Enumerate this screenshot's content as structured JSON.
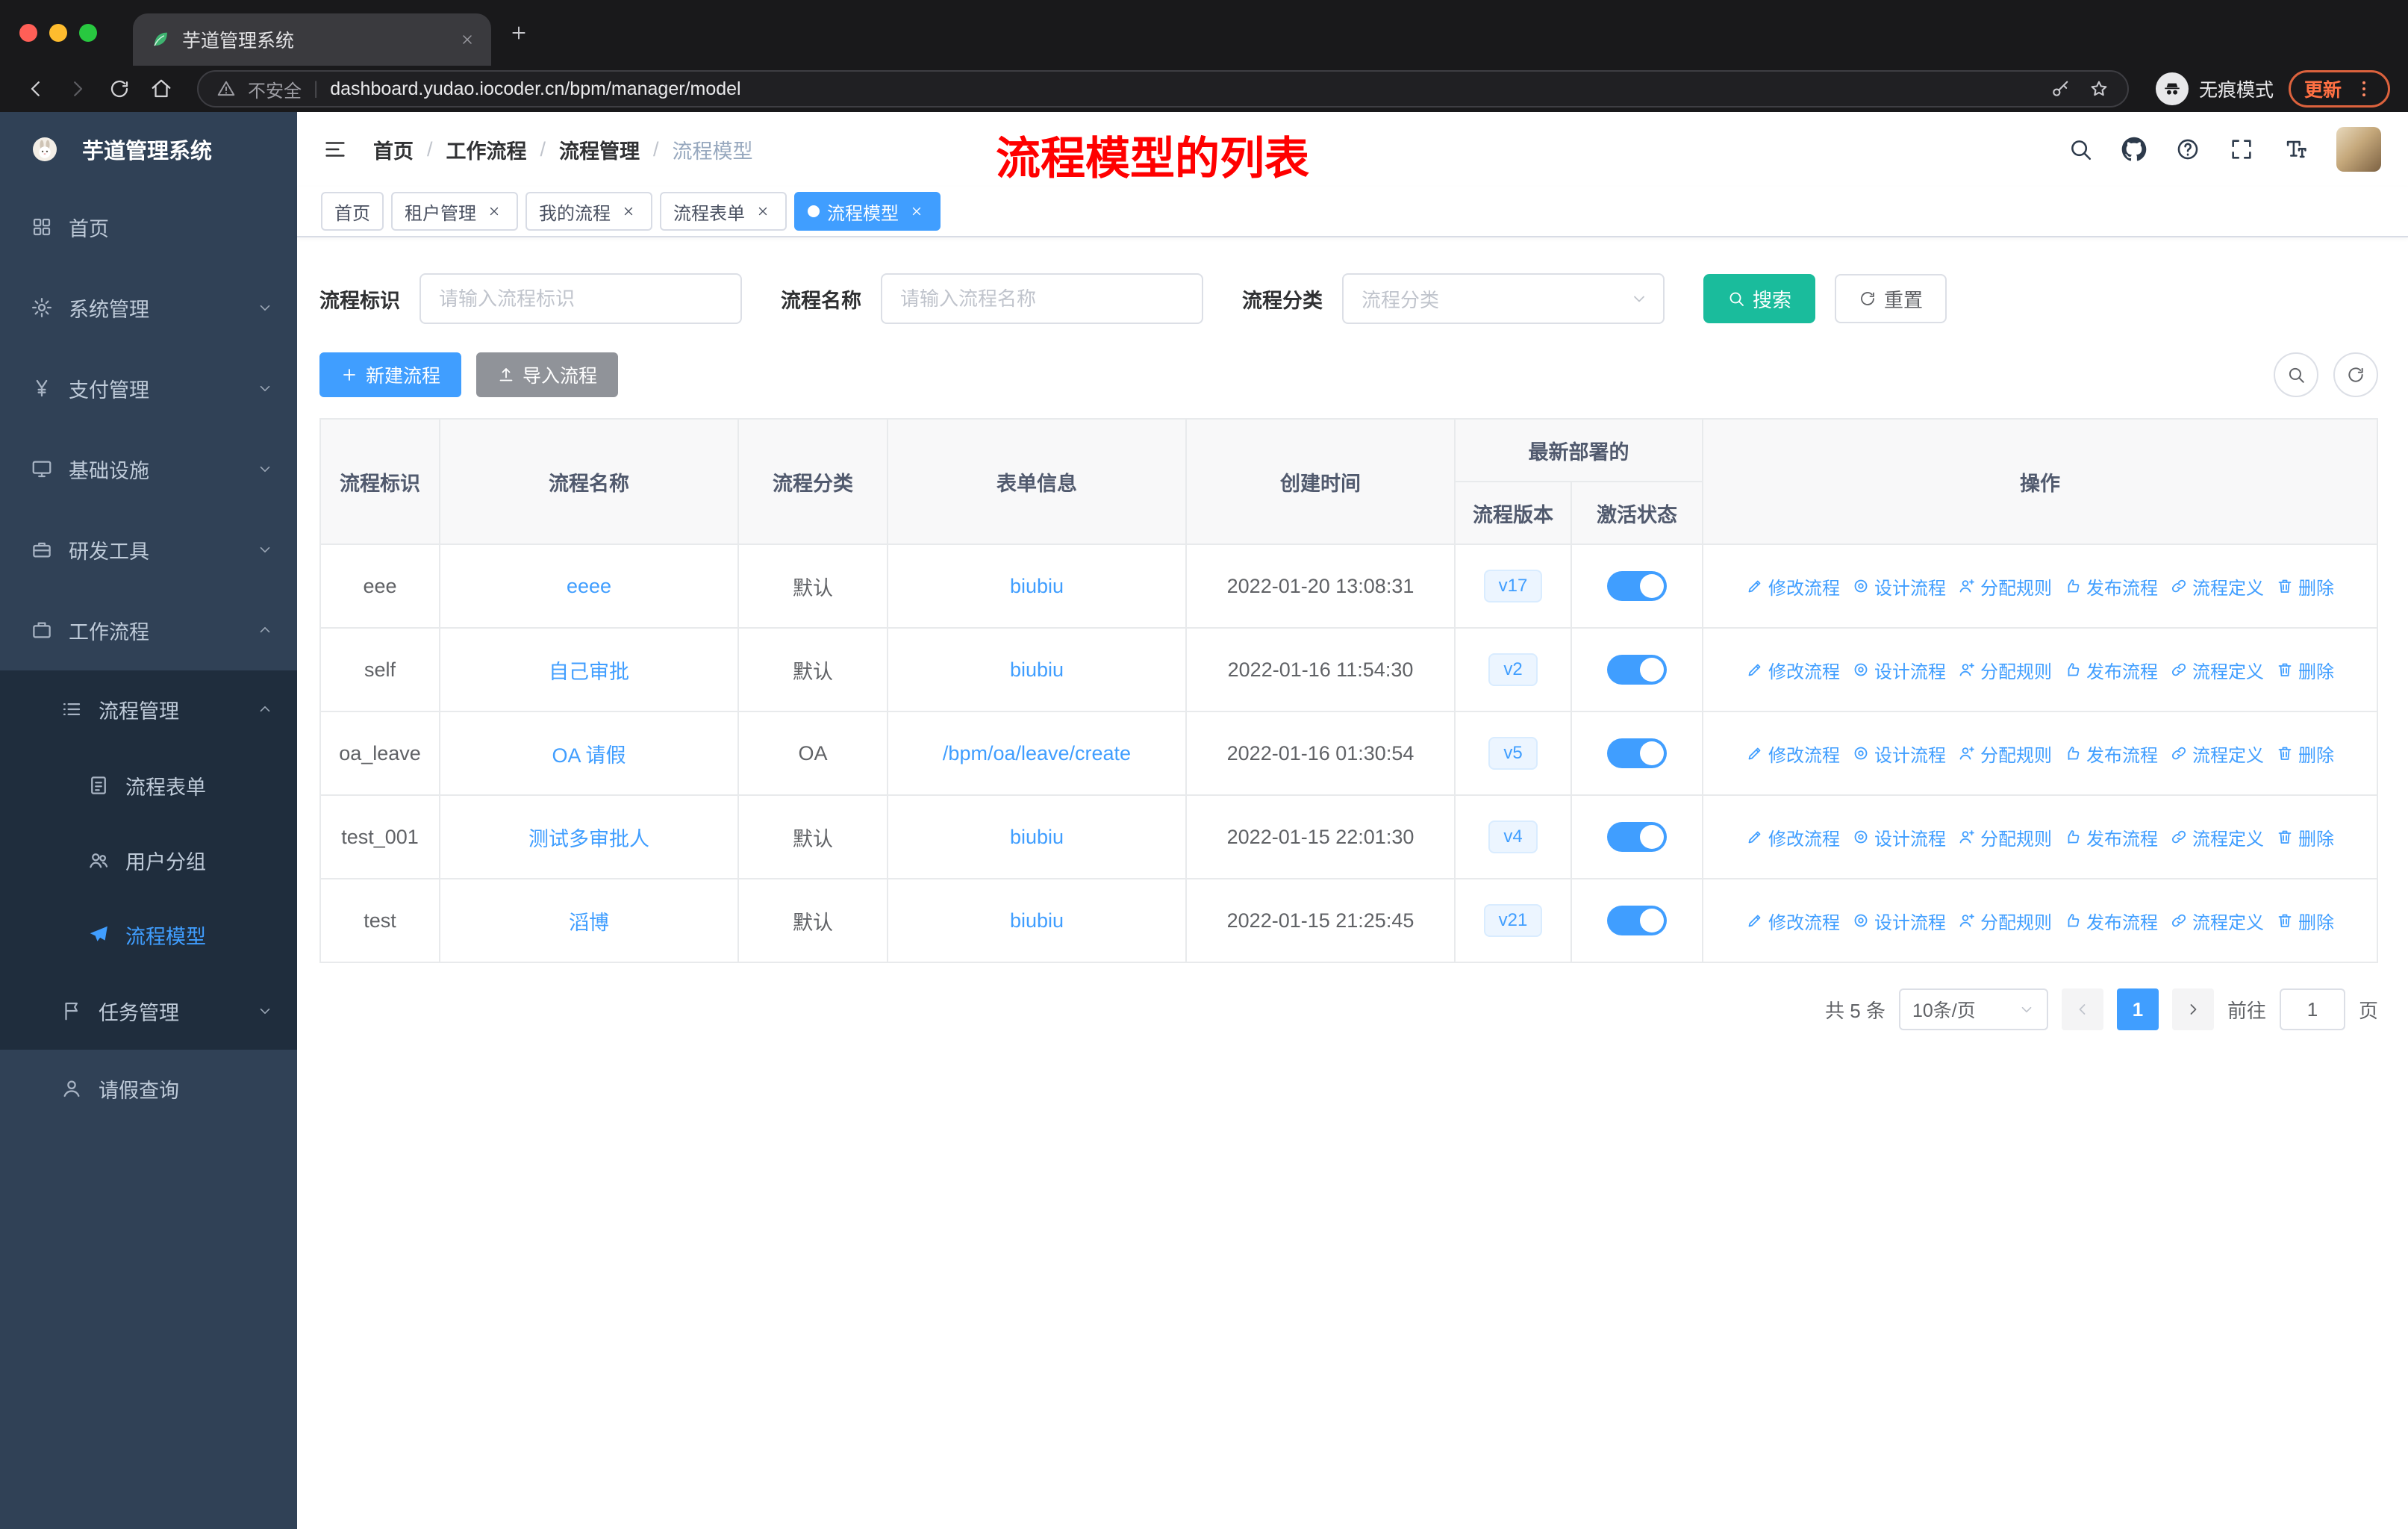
{
  "browser": {
    "tab_title": "芋道管理系统",
    "security_label": "不安全",
    "url": "dashboard.yudao.iocoder.cn/bpm/manager/model",
    "incognito_label": "无痕模式",
    "update_label": "更新"
  },
  "sidebar": {
    "logo_title": "芋道管理系统",
    "menu": [
      {
        "name": "home",
        "label": "首页",
        "icon": "dashboard-icon",
        "level": 1
      },
      {
        "name": "system-mgmt",
        "label": "系统管理",
        "icon": "gear-icon",
        "level": 1,
        "chevron": "down"
      },
      {
        "name": "payment-mgmt",
        "label": "支付管理",
        "icon": "yen-icon",
        "level": 1,
        "chevron": "down"
      },
      {
        "name": "infrastructure",
        "label": "基础设施",
        "icon": "monitor-icon",
        "level": 1,
        "chevron": "down"
      },
      {
        "name": "dev-tools",
        "label": "研发工具",
        "icon": "toolbox-icon",
        "level": 1,
        "chevron": "down"
      },
      {
        "name": "workflow",
        "label": "工作流程",
        "icon": "briefcase-icon",
        "level": 1,
        "chevron": "up"
      },
      {
        "name": "process-mgmt",
        "label": "流程管理",
        "icon": "list-icon",
        "level": 2,
        "chevron": "up",
        "dark": true
      },
      {
        "name": "process-form",
        "label": "流程表单",
        "icon": "document-icon",
        "level": 3,
        "dark": true
      },
      {
        "name": "user-group",
        "label": "用户分组",
        "icon": "users-icon",
        "level": 3,
        "dark": true
      },
      {
        "name": "process-model",
        "label": "流程模型",
        "icon": "send-icon",
        "level": 3,
        "dark": true,
        "active": true
      },
      {
        "name": "task-mgmt",
        "label": "任务管理",
        "icon": "flag-icon",
        "level": 2,
        "chevron": "down",
        "dark": true
      },
      {
        "name": "leave-query",
        "label": "请假查询",
        "icon": "user-icon",
        "level": 2
      }
    ]
  },
  "header": {
    "breadcrumb": [
      "首页",
      "工作流程",
      "流程管理",
      "流程模型"
    ],
    "annotation": "流程模型的列表"
  },
  "tags": [
    {
      "name": "home",
      "label": "首页",
      "closable": false,
      "active": false
    },
    {
      "name": "tenant-mgmt",
      "label": "租户管理",
      "closable": true,
      "active": false
    },
    {
      "name": "my-process",
      "label": "我的流程",
      "closable": true,
      "active": false
    },
    {
      "name": "process-form",
      "label": "流程表单",
      "closable": true,
      "active": false
    },
    {
      "name": "process-model",
      "label": "流程模型",
      "closable": true,
      "active": true
    }
  ],
  "filters": {
    "key_label": "流程标识",
    "key_placeholder": "请输入流程标识",
    "name_label": "流程名称",
    "name_placeholder": "请输入流程名称",
    "category_label": "流程分类",
    "category_placeholder": "流程分类",
    "search_label": "搜索",
    "reset_label": "重置"
  },
  "toolbar": {
    "create_label": "新建流程",
    "import_label": "导入流程"
  },
  "table": {
    "col_key": "流程标识",
    "col_name": "流程名称",
    "col_category": "流程分类",
    "col_form": "表单信息",
    "col_created": "创建时间",
    "group_header": "最新部署的",
    "col_version": "流程版本",
    "col_active": "激活状态",
    "col_ops": "操作",
    "actions": [
      {
        "name": "modify",
        "label": "修改流程",
        "icon": "edit-icon"
      },
      {
        "name": "design",
        "label": "设计流程",
        "icon": "design-icon"
      },
      {
        "name": "assign-rule",
        "label": "分配规则",
        "icon": "assign-user-icon"
      },
      {
        "name": "publish",
        "label": "发布流程",
        "icon": "publish-icon"
      },
      {
        "name": "definition",
        "label": "流程定义",
        "icon": "definition-icon"
      },
      {
        "name": "delete",
        "label": "删除",
        "icon": "trash-icon"
      }
    ],
    "rows": [
      {
        "key": "eee",
        "name": "eeee",
        "category": "默认",
        "form": "biubiu",
        "created": "2022-01-20 13:08:31",
        "version": "v17",
        "active": true
      },
      {
        "key": "self",
        "name": "自己审批",
        "category": "默认",
        "form": "biubiu",
        "created": "2022-01-16 11:54:30",
        "version": "v2",
        "active": true
      },
      {
        "key": "oa_leave",
        "name": "OA 请假",
        "category": "OA",
        "form": "/bpm/oa/leave/create",
        "created": "2022-01-16 01:30:54",
        "version": "v5",
        "active": true
      },
      {
        "key": "test_001",
        "name": "测试多审批人",
        "category": "默认",
        "form": "biubiu",
        "created": "2022-01-15 22:01:30",
        "version": "v4",
        "active": true
      },
      {
        "key": "test",
        "name": "滔博",
        "category": "默认",
        "form": "biubiu",
        "created": "2022-01-15 21:25:45",
        "version": "v21",
        "active": true
      }
    ]
  },
  "pagination": {
    "total": "共 5 条",
    "page_size": "10条/页",
    "page": "1",
    "goto_label": "前往",
    "goto_value": "1",
    "unit_label": "页"
  },
  "colors": {
    "accent": "#409EFF",
    "search_button": "#1ABC9C",
    "annotation": "#FF0000",
    "sidebar_bg": "#304156",
    "sidebar_submenu_bg": "#1F2D3D",
    "badge_bg": "#ECF5FF"
  }
}
